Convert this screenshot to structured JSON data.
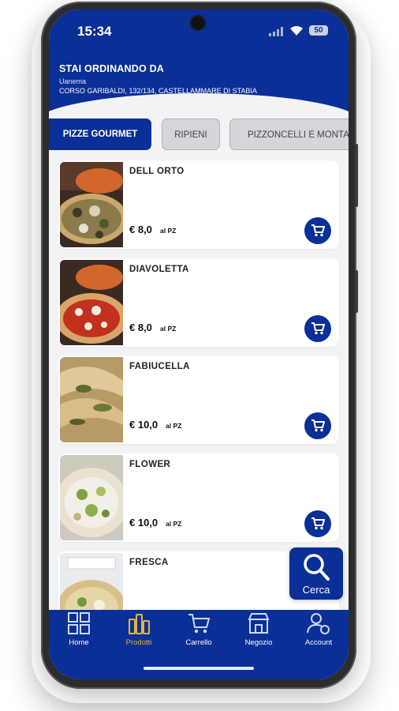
{
  "status": {
    "time": "15:34",
    "battery": "50"
  },
  "header": {
    "title": "STAI ORDINANDO DA",
    "shop": "Uanema",
    "address": "CORSO GARIBALDI, 132/134, CASTELLAMMARE DI STABIA"
  },
  "categories": [
    {
      "label": "PIZZE GOURMET",
      "active": true
    },
    {
      "label": "RIPIENI",
      "active": false
    },
    {
      "label": "PIZZONCELLI E MONTANARE",
      "active": false
    }
  ],
  "products": [
    {
      "name": "DELL ORTO",
      "price": "€ 8,0",
      "unit": "al PZ"
    },
    {
      "name": "DIAVOLETTA",
      "price": "€ 8,0",
      "unit": "al PZ"
    },
    {
      "name": "FABIUCELLA",
      "price": "€ 10,0",
      "unit": "al PZ"
    },
    {
      "name": "FLOWER",
      "price": "€ 10,0",
      "unit": "al PZ"
    },
    {
      "name": "FRESCA",
      "price": "",
      "unit": ""
    }
  ],
  "search": {
    "label": "Cerca"
  },
  "nav": [
    {
      "label": "Home",
      "icon": "home-grid-icon",
      "active": false
    },
    {
      "label": "Prodotti",
      "icon": "products-icon",
      "active": true
    },
    {
      "label": "Carrello",
      "icon": "cart-icon",
      "active": false
    },
    {
      "label": "Negozio",
      "icon": "store-icon",
      "active": false
    },
    {
      "label": "Account",
      "icon": "account-icon",
      "active": false
    }
  ],
  "colors": {
    "primary": "#0a2f96",
    "active_nav": "#e8b43b",
    "background": "#f2f3f5"
  }
}
